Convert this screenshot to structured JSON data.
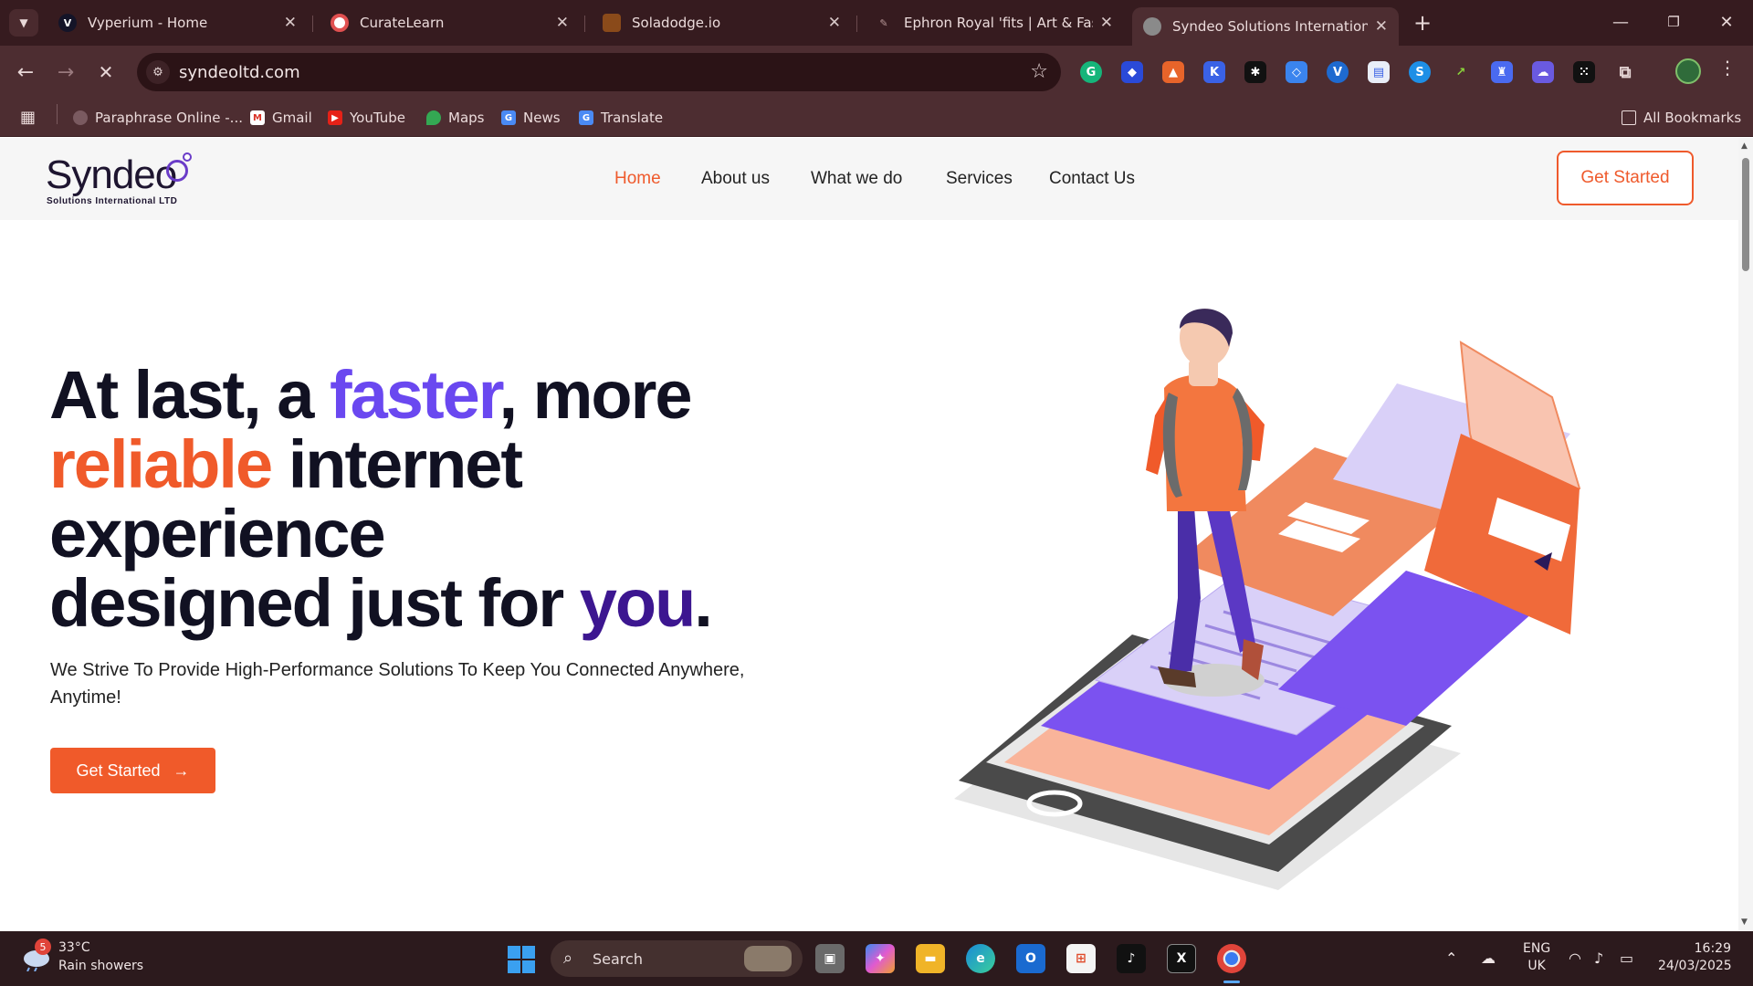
{
  "browser": {
    "tabs": [
      {
        "title": "Vyperium - Home",
        "icon": "vyperium-favicon",
        "active": false
      },
      {
        "title": "CurateLearn",
        "icon": "curatelearn-favicon",
        "active": false
      },
      {
        "title": "Soladodge.io",
        "icon": "soladodge-favicon",
        "active": false
      },
      {
        "title": "Ephron Royal 'fits | Art & Fashio",
        "icon": "ephron-favicon",
        "active": false
      },
      {
        "title": "Syndeo Solutions International",
        "icon": "globe-favicon",
        "active": true
      }
    ],
    "url": "syndeoltd.com",
    "bookmarks": [
      {
        "label": "Paraphrase Online -...",
        "icon": "paraphrase-icon"
      },
      {
        "label": "Gmail",
        "icon": "gmail-icon"
      },
      {
        "label": "YouTube",
        "icon": "youtube-icon"
      },
      {
        "label": "Maps",
        "icon": "maps-icon"
      },
      {
        "label": "News",
        "icon": "news-icon"
      },
      {
        "label": "Translate",
        "icon": "translate-icon"
      }
    ],
    "all_bookmarks_label": "All Bookmarks",
    "colors": {
      "frame": "#361b1f",
      "toolbar": "#4d2d31"
    }
  },
  "site": {
    "logo": {
      "word": "Syndeo",
      "tagline": "Solutions International LTD"
    },
    "nav": [
      {
        "label": "Home",
        "active": true
      },
      {
        "label": "About us",
        "active": false
      },
      {
        "label": "What we do",
        "active": false
      },
      {
        "label": "Services",
        "active": false
      },
      {
        "label": "Contact Us",
        "active": false
      }
    ],
    "header_cta": "Get Started",
    "hero": {
      "line1_a": "At last, a ",
      "line1_b": "faster",
      "line1_c": ", more",
      "line2_a": "reliable",
      "line2_b": " internet",
      "line3": "experience",
      "line4_a": "designed just for ",
      "line4_b": "you",
      "line4_c": ".",
      "subtitle": "We Strive To Provide High-Performance Solutions To Keep You Connected Anywhere, Anytime!",
      "cta": "Get Started"
    },
    "colors": {
      "accent_orange": "#f05a2a",
      "accent_purple": "#6a48f0",
      "deep_purple": "#3c1690"
    }
  },
  "taskbar": {
    "weather": {
      "badge": "5",
      "temp": "33°C",
      "desc": "Rain showers"
    },
    "search_label": "Search",
    "language": {
      "line1": "ENG",
      "line2": "UK"
    },
    "time": "16:29",
    "date": "24/03/2025"
  }
}
